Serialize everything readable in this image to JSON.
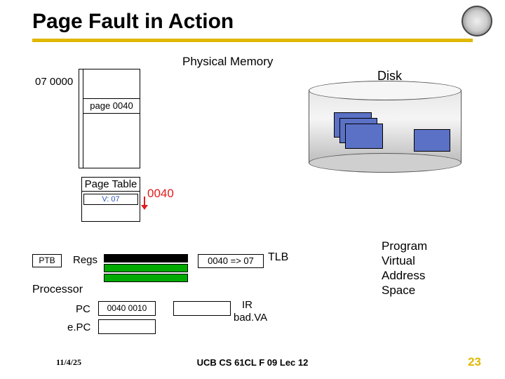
{
  "title": "Page Fault in Action",
  "seal": {
    "icon": "university-seal-icon"
  },
  "physical_memory": {
    "label": "Physical Memory",
    "index_hi": "07",
    "index_lo": "0000",
    "address_label": "07 0000",
    "page_label": "page 0040"
  },
  "page_table": {
    "label": "Page Table",
    "entry": "V: 07",
    "access": "0040"
  },
  "disk": {
    "label": "Disk"
  },
  "processor": {
    "ptb_label": "PTB",
    "regs_label": "Regs",
    "proc_label": "Processor",
    "pc_label": "PC",
    "pc_value": "0040 0010",
    "epc_label": "e.PC",
    "ir_label": "IR",
    "badva_label": "bad.VA"
  },
  "tlb": {
    "value": "0040 => 07",
    "label": "TLB"
  },
  "vas": {
    "line1": "Program",
    "line2": "Virtual",
    "line3": "Address",
    "line4": "Space"
  },
  "footer": {
    "date": "11/4/25",
    "course": "UCB CS 61CL F 09 Lec 12",
    "page": "23"
  }
}
